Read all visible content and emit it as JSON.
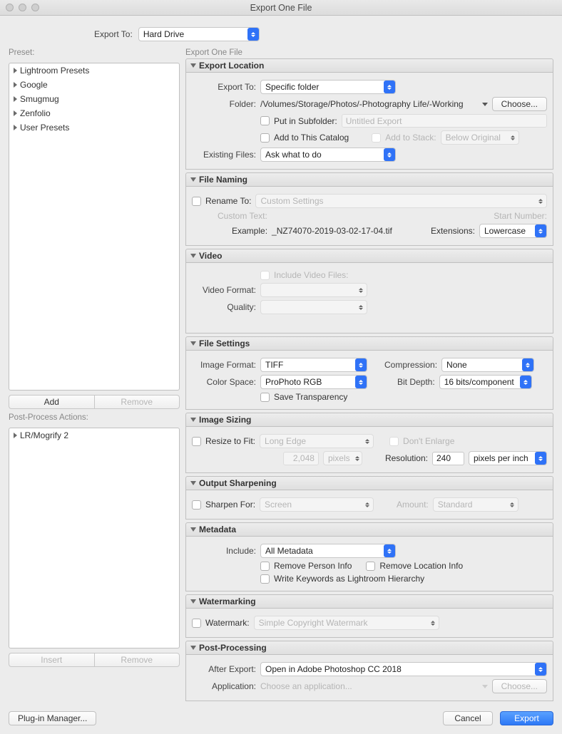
{
  "title": "Export One File",
  "export_to_label": "Export To:",
  "export_to_value": "Hard Drive",
  "preset_label": "Preset:",
  "presets": [
    "Lightroom Presets",
    "Google",
    "Smugmug",
    "Zenfolio",
    "User Presets"
  ],
  "btn_add": "Add",
  "btn_remove": "Remove",
  "btn_insert": "Insert",
  "post_actions_label": "Post-Process Actions:",
  "post_actions_items": [
    "LR/Mogrify 2"
  ],
  "right_title": "Export One File",
  "loc": {
    "title": "Export Location",
    "export_to_label": "Export To:",
    "export_to_value": "Specific folder",
    "folder_label": "Folder:",
    "folder_value": "/Volumes/Storage/Photos/-Photography Life/-Working",
    "choose": "Choose...",
    "put_subfolder_label": "Put in Subfolder:",
    "subfolder_placeholder": "Untitled Export",
    "add_catalog": "Add to This Catalog",
    "add_stack": "Add to Stack:",
    "stack_value": "Below Original",
    "existing_label": "Existing Files:",
    "existing_value": "Ask what to do"
  },
  "naming": {
    "title": "File Naming",
    "rename_label": "Rename To:",
    "rename_value": "Custom Settings",
    "custom_text_label": "Custom Text:",
    "start_number_label": "Start Number:",
    "example_label": "Example:",
    "example_value": "_NZ74070-2019-03-02-17-04.tif",
    "ext_label": "Extensions:",
    "ext_value": "Lowercase"
  },
  "video": {
    "title": "Video",
    "include_label": "Include Video Files:",
    "format_label": "Video Format:",
    "quality_label": "Quality:"
  },
  "settings": {
    "title": "File Settings",
    "format_label": "Image Format:",
    "format_value": "TIFF",
    "compression_label": "Compression:",
    "compression_value": "None",
    "colorspace_label": "Color Space:",
    "colorspace_value": "ProPhoto RGB",
    "bitdepth_label": "Bit Depth:",
    "bitdepth_value": "16 bits/component",
    "transparency_label": "Save Transparency"
  },
  "sizing": {
    "title": "Image Sizing",
    "resize_label": "Resize to Fit:",
    "resize_value": "Long Edge",
    "dont_enlarge": "Don't Enlarge",
    "dim_value": "2,048",
    "dim_unit": "pixels",
    "resolution_label": "Resolution:",
    "resolution_value": "240",
    "resolution_unit": "pixels per inch"
  },
  "sharpen": {
    "title": "Output Sharpening",
    "sharpen_label": "Sharpen For:",
    "sharpen_value": "Screen",
    "amount_label": "Amount:",
    "amount_value": "Standard"
  },
  "metadata": {
    "title": "Metadata",
    "include_label": "Include:",
    "include_value": "All Metadata",
    "remove_person": "Remove Person Info",
    "remove_location": "Remove Location Info",
    "keywords_hierarchy": "Write Keywords as Lightroom Hierarchy"
  },
  "watermark": {
    "title": "Watermarking",
    "watermark_label": "Watermark:",
    "watermark_value": "Simple Copyright Watermark"
  },
  "post": {
    "title": "Post-Processing",
    "after_label": "After Export:",
    "after_value": "Open in Adobe Photoshop CC 2018",
    "app_label": "Application:",
    "app_placeholder": "Choose an application...",
    "choose": "Choose..."
  },
  "footer": {
    "plugin": "Plug-in Manager...",
    "cancel": "Cancel",
    "export": "Export"
  }
}
